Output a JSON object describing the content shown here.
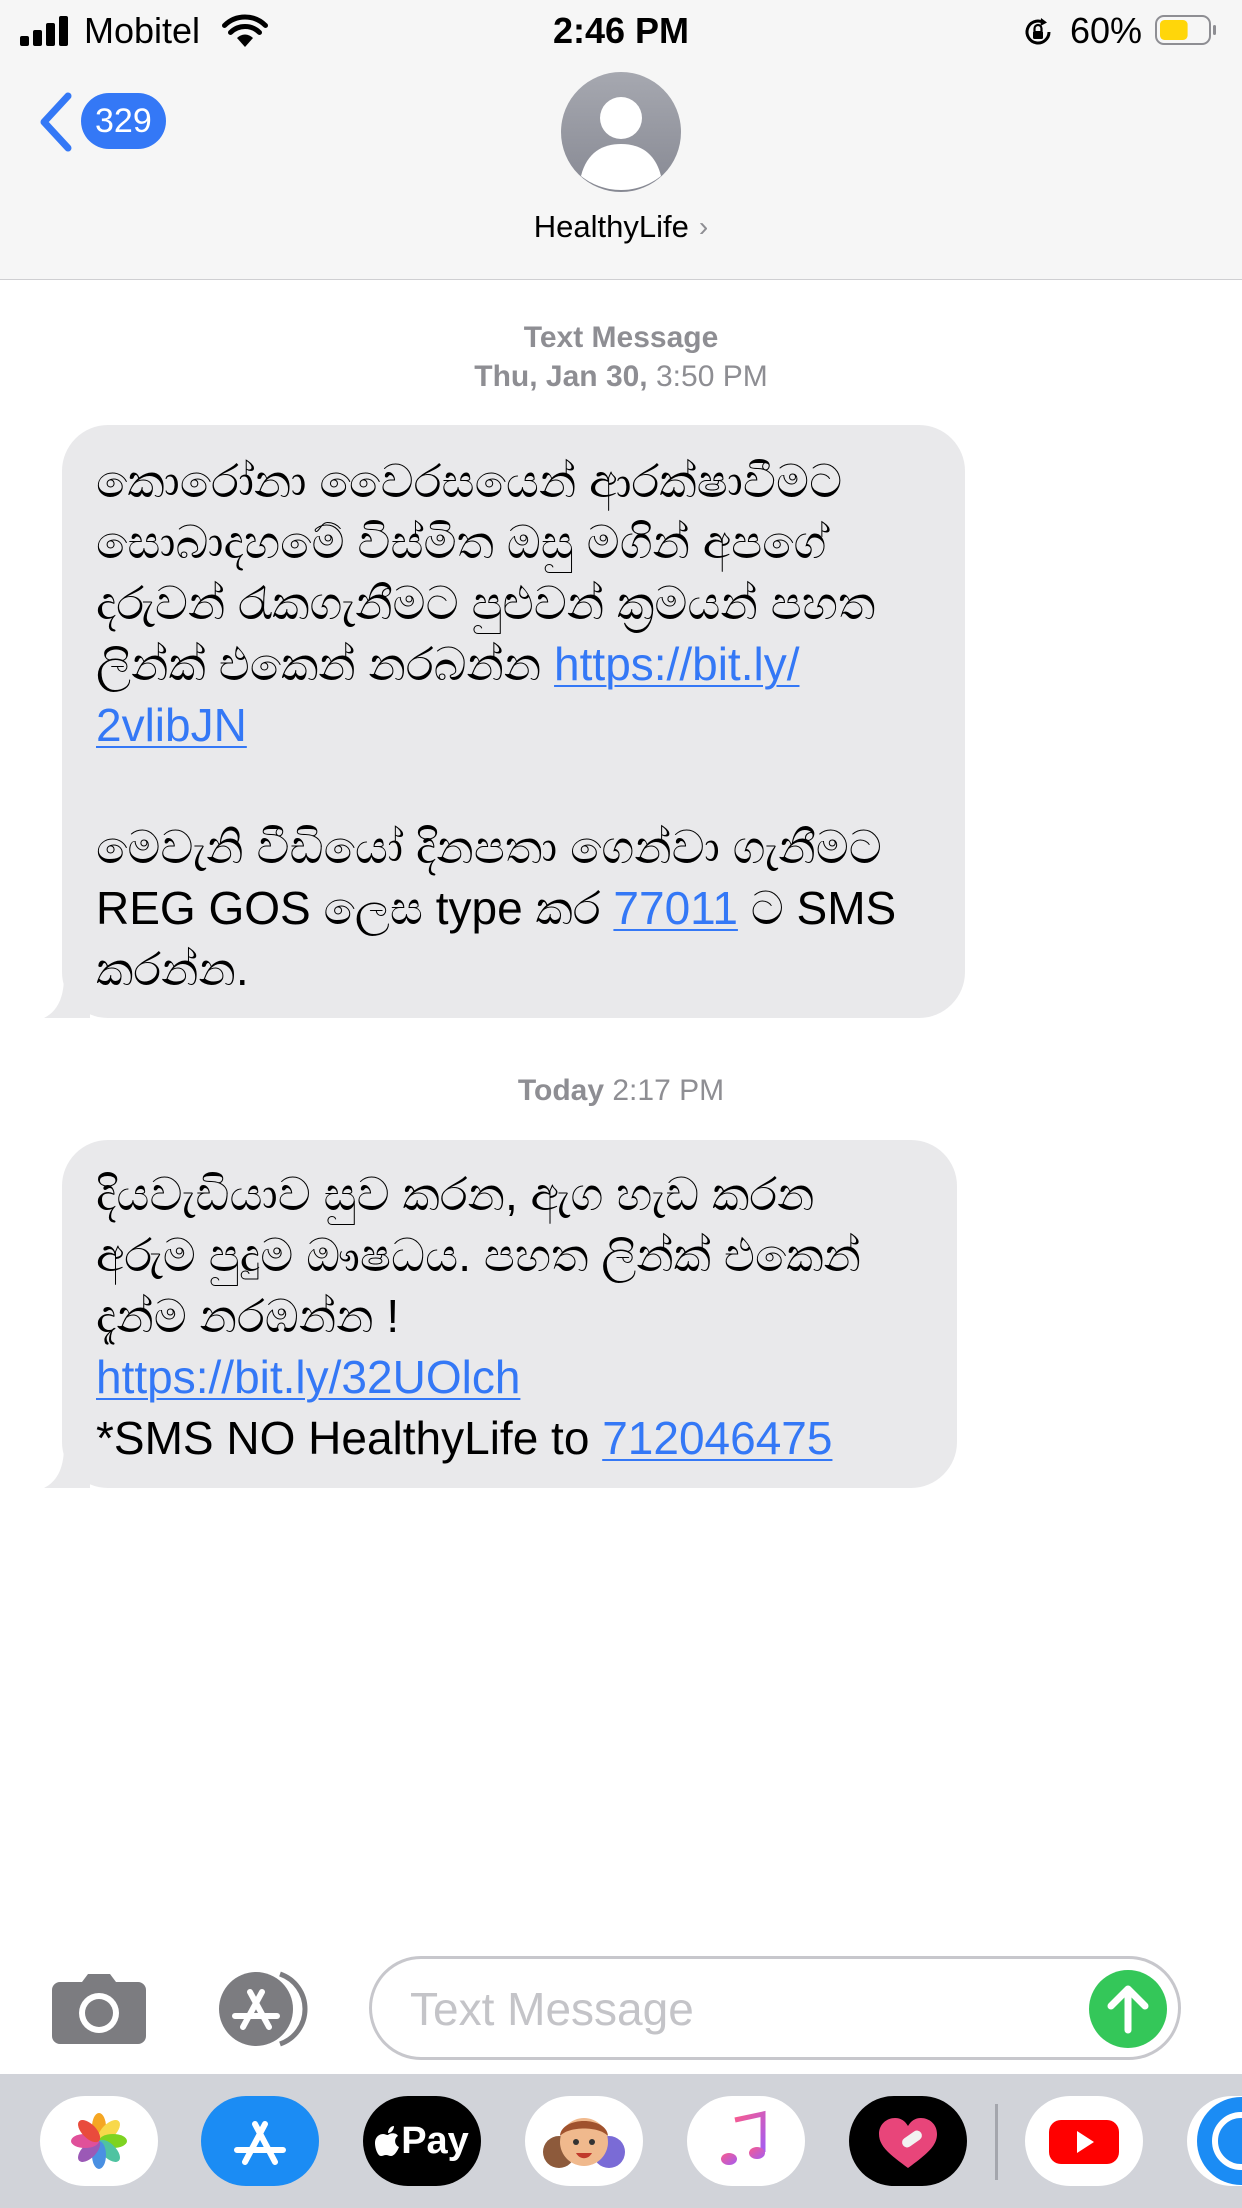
{
  "status_bar": {
    "carrier": "Mobitel",
    "time": "2:46 PM",
    "battery_percent": "60%",
    "battery_level": 0.6,
    "icons": [
      "signal-bars-icon",
      "wifi-icon",
      "orientation-lock-icon",
      "battery-icon"
    ]
  },
  "header": {
    "back_count": "329",
    "contact_name": "HealthyLife",
    "contact_chevron": "›",
    "avatar_icon": "person-silhouette-icon"
  },
  "conversation": {
    "timestamp_1": {
      "label": "Text Message",
      "day": "Thu, Jan 30,",
      "time": " 3:50 PM"
    },
    "message_1": {
      "lines": [
        "කොරෝනා වෛරසයෙන් ආරක්ෂාවීමට",
        "සොබාදහමේ විස්මිත ඔසු මගින් අපගේ",
        "දරුවන් රැකගැනීමට පුළුවන් ක්‍රමයන් පහත",
        "ලින්ක් එකෙන් නරබන්න "
      ],
      "link_part_1": "https://bit.ly/",
      "link_part_2": "2vlibJN",
      "line_6": "මෙවැනි වීඩියෝ දිනපතා ගෙන්වා ගැනීමට",
      "line_7_prefix": "REG GOS ලෙස type කර ",
      "phone_link": "77011",
      "line_7_suffix": " ට SMS",
      "line_8": "කරන්න."
    },
    "timestamp_2": {
      "day": "Today",
      "time": " 2:17 PM"
    },
    "message_2": {
      "lines": [
        "දියවැඩියාව සුව කරන, ඇග හැඩ කරන",
        "අරුම පුදුම ඖෂධය. පහත ලින්ක් එකෙන්",
        "දැන්ම නරඹන්න !"
      ],
      "link": "https://bit.ly/32UOlch",
      "sms_prefix": "*SMS NO HealthyLife to ",
      "phone_link": "712046475"
    }
  },
  "composer": {
    "placeholder": "Text Message",
    "camera_icon": "camera-icon",
    "apps_icon": "app-store-icon",
    "send_icon": "send-arrow-up-icon"
  },
  "app_drawer": {
    "apps": [
      "Photos",
      "App Store",
      "Apple Pay",
      "Memoji",
      "Music",
      "Heart",
      "YouTube"
    ],
    "apple_pay_label": "Pay"
  },
  "colors": {
    "accent_blue": "#3478f6",
    "bubble_gray": "#e9e9eb",
    "send_green": "#34c759",
    "header_bg": "#f6f6f6",
    "drawer_bg": "#d1d3d9"
  }
}
